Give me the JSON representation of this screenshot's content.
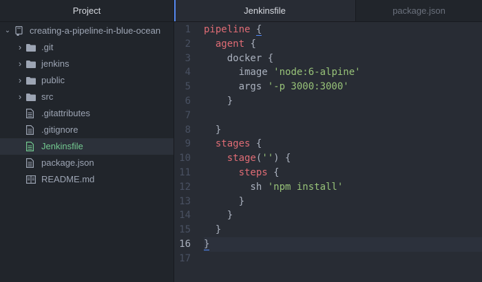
{
  "sidebar": {
    "title": "Project",
    "root": "creating-a-pipeline-in-blue-ocean",
    "items": [
      {
        "label": ".git",
        "kind": "folder"
      },
      {
        "label": "jenkins",
        "kind": "folder"
      },
      {
        "label": "public",
        "kind": "folder"
      },
      {
        "label": "src",
        "kind": "folder"
      },
      {
        "label": ".gitattributes",
        "kind": "file"
      },
      {
        "label": ".gitignore",
        "kind": "file"
      },
      {
        "label": "Jenkinsfile",
        "kind": "file",
        "selected": true
      },
      {
        "label": "package.json",
        "kind": "file"
      },
      {
        "label": "README.md",
        "kind": "readme"
      }
    ]
  },
  "tabs": [
    {
      "label": "Jenkinsfile",
      "active": true
    },
    {
      "label": "package.json",
      "active": false
    }
  ],
  "editor": {
    "line_numbers": [
      "1",
      "2",
      "3",
      "4",
      "5",
      "6",
      "7",
      "8",
      "9",
      "10",
      "11",
      "12",
      "13",
      "14",
      "15",
      "16",
      "17"
    ],
    "current_line": "16",
    "lines": [
      [
        {
          "t": "pipeline ",
          "c": "kw"
        },
        {
          "t": "{",
          "c": "br-match"
        }
      ],
      [
        {
          "t": "  "
        },
        {
          "t": "agent ",
          "c": "kw"
        },
        {
          "t": "{"
        }
      ],
      [
        {
          "t": "    docker {"
        }
      ],
      [
        {
          "t": "      image "
        },
        {
          "t": "'node:6-alpine'",
          "c": "str"
        }
      ],
      [
        {
          "t": "      args "
        },
        {
          "t": "'-p 3000:3000'",
          "c": "str"
        }
      ],
      [
        {
          "t": "    }"
        }
      ],
      [
        {
          "t": ""
        }
      ],
      [
        {
          "t": "  }"
        }
      ],
      [
        {
          "t": "  "
        },
        {
          "t": "stages ",
          "c": "kw"
        },
        {
          "t": "{"
        }
      ],
      [
        {
          "t": "    "
        },
        {
          "t": "stage",
          "c": "kw"
        },
        {
          "t": "("
        },
        {
          "t": "''",
          "c": "str"
        },
        {
          "t": ") {"
        }
      ],
      [
        {
          "t": "      "
        },
        {
          "t": "steps ",
          "c": "kw"
        },
        {
          "t": "{"
        }
      ],
      [
        {
          "t": "        sh "
        },
        {
          "t": "'npm install'",
          "c": "str"
        }
      ],
      [
        {
          "t": "      }"
        }
      ],
      [
        {
          "t": "    }"
        }
      ],
      [
        {
          "t": "  }"
        }
      ],
      [
        {
          "t": "}",
          "c": "br-match"
        }
      ],
      [
        {
          "t": ""
        }
      ]
    ]
  },
  "colors": {
    "keyword": "#e06c75",
    "string": "#98c379",
    "selected_file": "#73c990",
    "accent": "#568af2"
  }
}
